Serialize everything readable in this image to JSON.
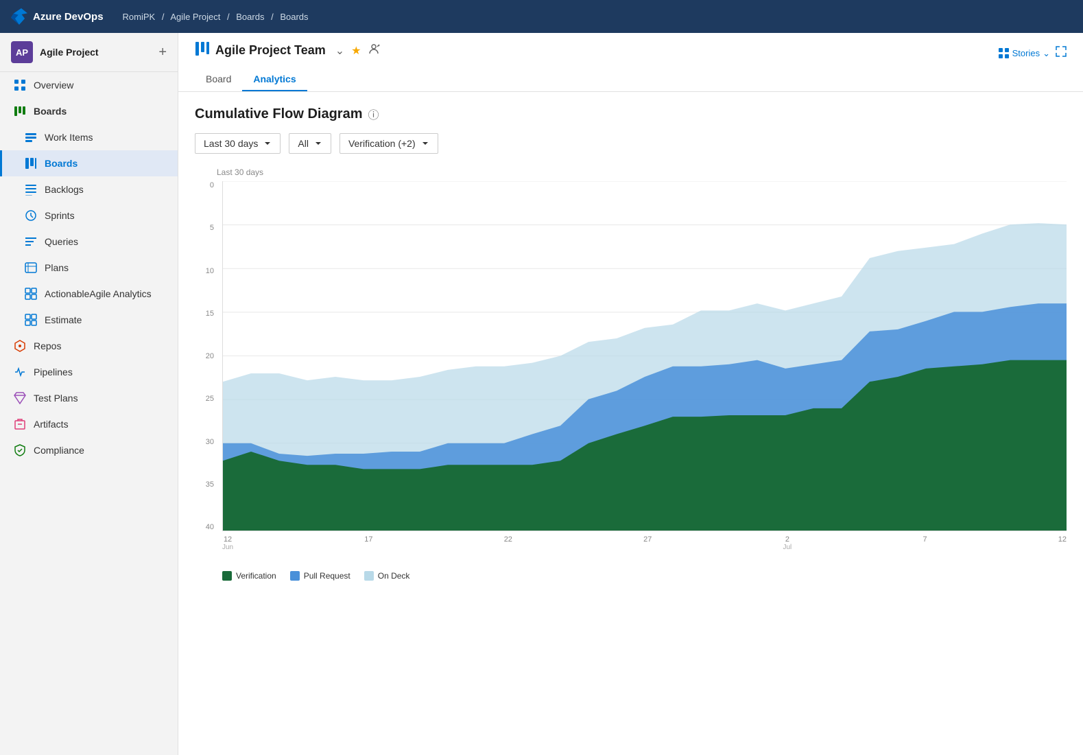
{
  "topbar": {
    "logo_text": "Azure DevOps",
    "breadcrumb": [
      "RomiPK",
      "Agile Project",
      "Boards",
      "Boards"
    ]
  },
  "sidebar": {
    "project_name": "Agile Project",
    "project_initials": "AP",
    "nav_items": [
      {
        "id": "overview",
        "label": "Overview",
        "icon": "overview"
      },
      {
        "id": "boards-group",
        "label": "Boards",
        "icon": "boards-group",
        "is_group": true
      },
      {
        "id": "work-items",
        "label": "Work Items",
        "icon": "work-items"
      },
      {
        "id": "boards",
        "label": "Boards",
        "icon": "boards",
        "active": true
      },
      {
        "id": "backlogs",
        "label": "Backlogs",
        "icon": "backlogs"
      },
      {
        "id": "sprints",
        "label": "Sprints",
        "icon": "sprints"
      },
      {
        "id": "queries",
        "label": "Queries",
        "icon": "queries"
      },
      {
        "id": "plans",
        "label": "Plans",
        "icon": "plans"
      },
      {
        "id": "actionable-agile",
        "label": "ActionableAgile Analytics",
        "icon": "actionable"
      },
      {
        "id": "estimate",
        "label": "Estimate",
        "icon": "estimate"
      },
      {
        "id": "repos",
        "label": "Repos",
        "icon": "repos"
      },
      {
        "id": "pipelines",
        "label": "Pipelines",
        "icon": "pipelines"
      },
      {
        "id": "test-plans",
        "label": "Test Plans",
        "icon": "test-plans"
      },
      {
        "id": "artifacts",
        "label": "Artifacts",
        "icon": "artifacts"
      },
      {
        "id": "compliance",
        "label": "Compliance",
        "icon": "compliance"
      }
    ]
  },
  "content": {
    "team_name": "Agile Project Team",
    "tabs": [
      {
        "id": "board",
        "label": "Board",
        "active": false
      },
      {
        "id": "analytics",
        "label": "Analytics",
        "active": true
      }
    ],
    "stories_label": "Stories",
    "chart": {
      "title": "Cumulative Flow Diagram",
      "filters": [
        {
          "id": "time-range",
          "value": "Last 30 days"
        },
        {
          "id": "type",
          "value": "All"
        },
        {
          "id": "columns",
          "value": "Verification (+2)"
        }
      ],
      "label_top": "Last 30 days",
      "y_labels": [
        "0",
        "5",
        "10",
        "15",
        "20",
        "25",
        "30",
        "35",
        "40"
      ],
      "x_labels": [
        {
          "day": "12",
          "month": "Jun"
        },
        {
          "day": "17",
          "month": ""
        },
        {
          "day": "22",
          "month": ""
        },
        {
          "day": "27",
          "month": ""
        },
        {
          "day": "2",
          "month": "Jul"
        },
        {
          "day": "7",
          "month": ""
        },
        {
          "day": "12",
          "month": ""
        }
      ],
      "legend": [
        {
          "id": "verification",
          "label": "Verification",
          "color": "#1a6b3a"
        },
        {
          "id": "pull-request",
          "label": "Pull Request",
          "color": "#4a90d9"
        },
        {
          "id": "on-deck",
          "label": "On Deck",
          "color": "#b8d9e8"
        }
      ]
    }
  }
}
